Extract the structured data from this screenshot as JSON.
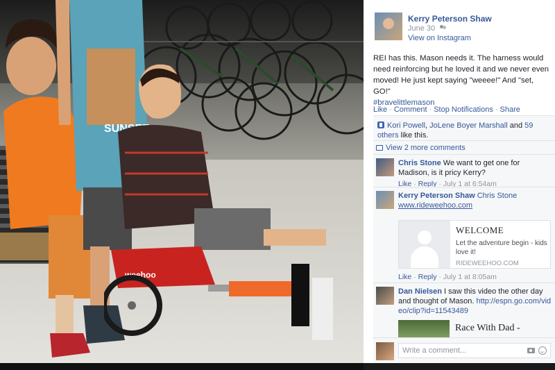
{
  "post": {
    "author": "Kerry Peterson Shaw",
    "date": "June 30",
    "via": "View on Instagram",
    "text": "REI has this. Mason needs it. The harness would need reinforcing but he loved it and we never even moved! He just kept saying \"weeee!\" And \"set, GO!\"",
    "hashtag": "#bravelittlemason"
  },
  "actions": {
    "like": "Like",
    "comment": "Comment",
    "notifications": "Stop Notifications",
    "share": "Share",
    "separator": "·"
  },
  "likes": {
    "name1": "Kori Powell",
    "sep1": ",",
    "name2": "JoLene Boyer Marshall",
    "and": "and",
    "others": "59 others",
    "suffix": "like this."
  },
  "view_more": "View 2 more comments",
  "comments": [
    {
      "name": "Chris Stone",
      "text": "We want to get one for Madison, is it pricy Kerry?",
      "like": "Like",
      "reply": "Reply",
      "time": "July 1 at 6:54am",
      "sep": "·"
    },
    {
      "name": "Kerry Peterson Shaw",
      "mention": "Chris Stone",
      "link": "www.rideweehoo.com",
      "like": "Like",
      "reply": "Reply",
      "time": "July 1 at 8:05am",
      "sep": "·",
      "preview": {
        "title": "WELCOME",
        "desc": "Let the adventure begin - kids love it!",
        "domain": "RIDEWEEHOO.COM"
      }
    },
    {
      "name": "Dan Nielsen",
      "text": "I saw this video the other day and thought of Mason.",
      "link": "http://espn.go.com/video/clip?id=11543489",
      "preview": {
        "title": "Race With Dad -"
      }
    }
  ],
  "composer": {
    "placeholder": "Write a comment..."
  },
  "photo": {
    "shirt_text": "SUNSET",
    "trailer_brand": "weehoo"
  },
  "colors": {
    "link": "#365899",
    "meta": "#90949c",
    "ufi_bg": "#f6f7f9"
  }
}
